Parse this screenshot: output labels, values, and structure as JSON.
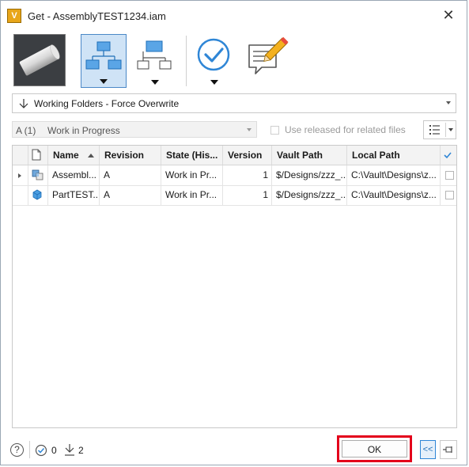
{
  "window": {
    "title": "Get - AssemblyTEST1234.iam",
    "app_icon_glyph": "V",
    "close_glyph": "✕"
  },
  "toolbar": {
    "buttons": [
      {
        "name": "thumbnail",
        "icon": "part-preview"
      },
      {
        "name": "children",
        "icon": "children-structure-icon",
        "selected": true
      },
      {
        "name": "parents",
        "icon": "parents-structure-icon"
      },
      {
        "name": "check",
        "icon": "checkmark-circle-icon"
      },
      {
        "name": "comment",
        "icon": "note-pencil-icon"
      }
    ]
  },
  "location_combo": {
    "value": "Working Folders - Force Overwrite"
  },
  "revision": {
    "rev_value": "A (1)",
    "state_value": "Work in Progress",
    "use_released_label": "Use released for related files"
  },
  "grid": {
    "headers": {
      "name": "Name",
      "revision": "Revision",
      "state": "State (His...",
      "version": "Version",
      "vault_path": "Vault Path",
      "local_path": "Local Path"
    },
    "rows": [
      {
        "name": "Assembl...",
        "revision": "A",
        "state": "Work in Pr...",
        "version": "1",
        "vault_path": "$/Designs/zzz_...",
        "local_path": "C:\\Vault\\Designs\\z...",
        "type": "assembly",
        "expandable": true
      },
      {
        "name": "PartTEST...",
        "revision": "A",
        "state": "Work in Pr...",
        "version": "1",
        "vault_path": "$/Designs/zzz_...",
        "local_path": "C:\\Vault\\Designs\\z...",
        "type": "part",
        "expandable": false
      }
    ]
  },
  "footer": {
    "help_glyph": "?",
    "check_count": "0",
    "download_count": "2",
    "ok_label": "OK",
    "collapse_label": "<<"
  },
  "colors": {
    "accent": "#2f86d6",
    "highlight": "#e3001b",
    "selected_bg": "#cfe3f6"
  }
}
